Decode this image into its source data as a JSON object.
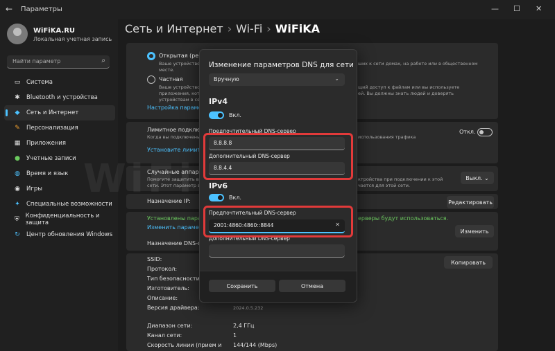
{
  "window": {
    "title": "Параметры",
    "back_icon": "arrow-left-icon"
  },
  "user": {
    "name": "WiFiKA.RU",
    "type": "Локальная учетная запись"
  },
  "search": {
    "placeholder": "Найти параметр"
  },
  "sidebar": {
    "items": [
      {
        "label": "Система",
        "icon": "system-icon",
        "glyph": "▭"
      },
      {
        "label": "Bluetooth и устройства",
        "icon": "bluetooth-icon",
        "glyph": "✱"
      },
      {
        "label": "Сеть и Интернет",
        "icon": "wifi-icon",
        "glyph": "◆"
      },
      {
        "label": "Персонализация",
        "icon": "brush-icon",
        "glyph": "✎"
      },
      {
        "label": "Приложения",
        "icon": "apps-icon",
        "glyph": "▦"
      },
      {
        "label": "Учетные записи",
        "icon": "account-icon",
        "glyph": "●"
      },
      {
        "label": "Время и язык",
        "icon": "globe-icon",
        "glyph": "◍"
      },
      {
        "label": "Игры",
        "icon": "gamepad-icon",
        "glyph": "◉"
      },
      {
        "label": "Специальные возможности",
        "icon": "accessibility-icon",
        "glyph": "✦"
      },
      {
        "label": "Конфиденциальность и защита",
        "icon": "shield-icon",
        "glyph": "⛨"
      },
      {
        "label": "Центр обновления Windows",
        "icon": "update-icon",
        "glyph": "↻"
      }
    ]
  },
  "breadcrumb": {
    "part1": "Сеть и Интернет",
    "part2": "Wi-Fi",
    "current": "WiFiKA",
    "sep": "›"
  },
  "background": {
    "public_label": "Открытая (реко",
    "public_desc_1": "Ваше устройство н",
    "public_desc_1r": "ших к сети домах, на работе или в общественном",
    "public_desc_2": "месте.",
    "private_label": "Частная",
    "private_desc_1": "Ваше устройство",
    "private_desc_1r": "щий доступ к файлам или вы используете",
    "private_desc_2": "приложения, кото",
    "private_desc_2r": "ей. Вы должны знать людей и доверять",
    "private_desc_3": "устройствам в сет",
    "firewall_link": "Настройка параметр",
    "metered_label": "Лимитное подключ",
    "metered_desc": "Когда вы подключены",
    "metered_desc_r": "использования трафика",
    "metered_state": "Откл.",
    "limit_link": "Установите лимит тр",
    "random_label": "Случайные аппарат",
    "random_desc_1": "Помогите защитить ва",
    "random_desc_1r": "ктройства при подключении к этой",
    "random_desc_2": "сети. Этот параметр вс",
    "random_desc_2r": "чается для этой сети.",
    "random_value": "Выкл.",
    "ip_label": "Назначение IP:",
    "edit_button": "Редактировать",
    "dns_status": "Установлены пара",
    "dns_status_r": "ерверы будут использоваться.",
    "change_link": "Изменить параметр",
    "change_button": "Изменить",
    "dns_assign_label": "Назначение DNS-серв",
    "props": [
      "SSID:",
      "Протокол:",
      "Тип безопасности:",
      "Изготовитель:",
      "Описание:",
      "Версия драйвера:"
    ],
    "driver_version": "2024.0.5.232",
    "copy_button": "Копировать",
    "band_label": "Диапазон сети:",
    "band_value": "2,4 ГГц",
    "channel_label": "Канал сети:",
    "channel_value": "1",
    "speed_label": "Скорость линии (прием и",
    "speed_value": "144/144 (Mbps)"
  },
  "watermark": "WiFiKA.RU",
  "dialog": {
    "title": "Изменение параметров DNS для сети",
    "mode": "Вручную",
    "ipv4": {
      "heading": "IPv4",
      "toggle_label": "Вкл.",
      "preferred_label": "Предпочтительный DNS-сервер",
      "preferred_value": "8.8.8.8",
      "alternate_label": "Дополнительный DNS-сервер",
      "alternate_value": "8.8.4.4"
    },
    "ipv6": {
      "heading": "IPv6",
      "toggle_label": "Вкл.",
      "preferred_label": "Предпочтительный DNS-сервер",
      "preferred_value": "2001:4860:4860::8844",
      "alternate_label": "Дополнительный DNS-сервер",
      "alternate_value": ""
    },
    "save_label": "Сохранить",
    "cancel_label": "Отмена"
  },
  "colors": {
    "accent": "#4cc2ff",
    "highlight": "#e23a3a",
    "status_green": "#6ccb5f"
  }
}
